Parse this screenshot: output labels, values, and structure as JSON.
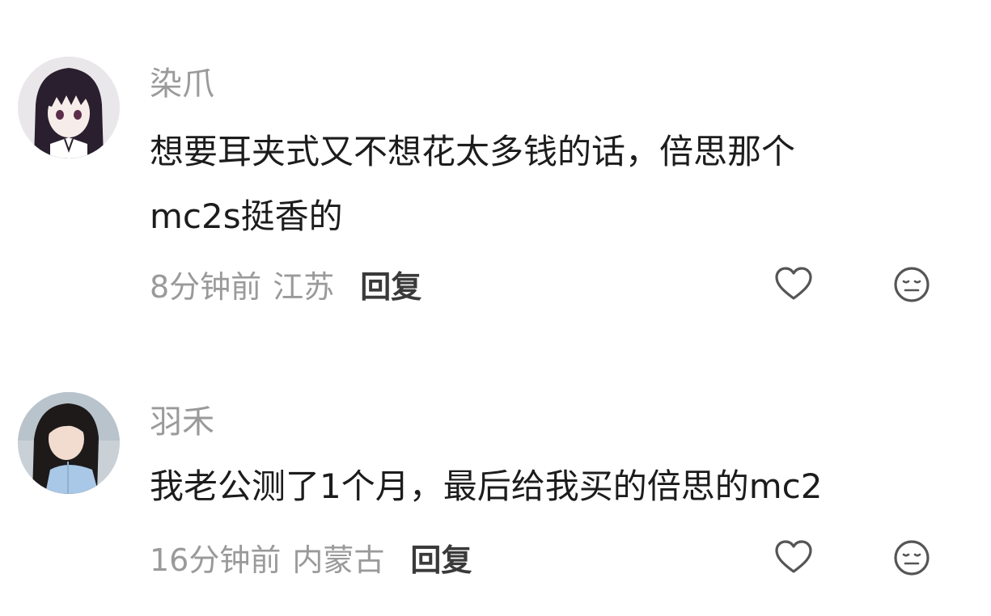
{
  "comments": [
    {
      "username": "染爪",
      "text_lines": [
        "想要耳夹式又不想花太多钱的话，倍思那个",
        "mc2s挺香的"
      ],
      "time": "8分钟前",
      "location": "江苏",
      "reply_label": "回复",
      "like_icon": "heart-outline-icon",
      "dislike_icon": "meh-face-icon"
    },
    {
      "username": "羽禾",
      "text_lines": [
        "我老公测了1个月，最后给我买的倍思的mc2"
      ],
      "time": "16分钟前",
      "location": "内蒙古",
      "reply_label": "回复",
      "like_icon": "heart-outline-icon",
      "dislike_icon": "meh-face-icon"
    }
  ],
  "colors": {
    "muted_text": "#9a9a9a",
    "body_text": "#1c1c1c",
    "reply_text": "#3a3a3a",
    "icon_stroke": "#555555"
  }
}
